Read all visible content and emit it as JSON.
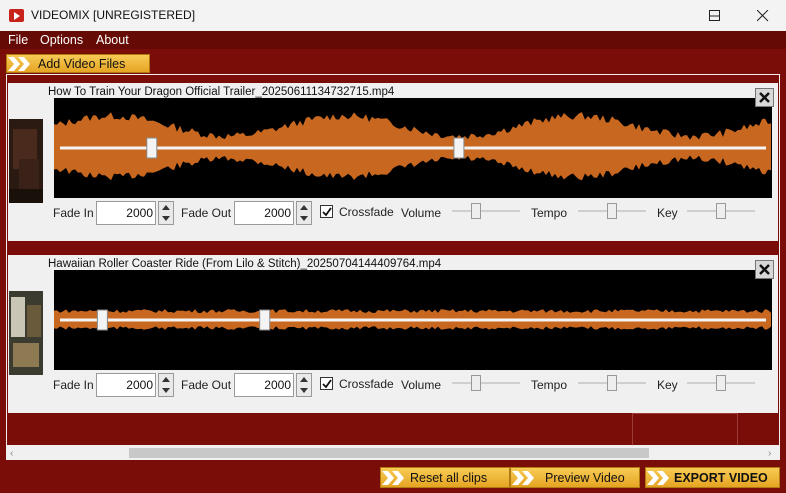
{
  "window": {
    "title": "VIDEOMIX [UNREGISTERED]"
  },
  "menu": [
    {
      "label": "File"
    },
    {
      "label": "Options"
    },
    {
      "label": "About"
    }
  ],
  "toolbar": {
    "add_label": "Add Video Files"
  },
  "clips": [
    {
      "filename": "How To Train Your Dragon  Official Trailer_20250611134732715.mp4",
      "fade_in_label": "Fade In",
      "fade_in": "2000",
      "fade_out_label": "Fade Out",
      "fade_out": "2000",
      "crossfade_label": "Crossfade",
      "crossfade_checked": true,
      "volume_label": "Volume",
      "tempo_label": "Tempo",
      "key_label": "Key",
      "trim_start": 0.13,
      "trim_end": 0.565,
      "volume_level": 0.33,
      "tempo_level": 0.5,
      "key_level": 0.5
    },
    {
      "filename": "Hawaiian Roller Coaster Ride (From Lilo & Stitch)_20250704144409764.mp4",
      "fade_in_label": "Fade In",
      "fade_in": "2000",
      "fade_out_label": "Fade Out",
      "fade_out": "2000",
      "crossfade_label": "Crossfade",
      "crossfade_checked": true,
      "volume_label": "Volume",
      "tempo_label": "Tempo",
      "key_label": "Key",
      "trim_start": 0.06,
      "trim_end": 0.29,
      "volume_level": 0.33,
      "tempo_level": 0.5,
      "key_level": 0.5
    }
  ],
  "footer": {
    "reset_label": "Reset all clips",
    "preview_label": "Preview Video",
    "export_label": "EXPORT VIDEO"
  },
  "colors": {
    "accent": "#f2b83a",
    "background": "#7a0d08",
    "waveform": "#c8671f"
  }
}
